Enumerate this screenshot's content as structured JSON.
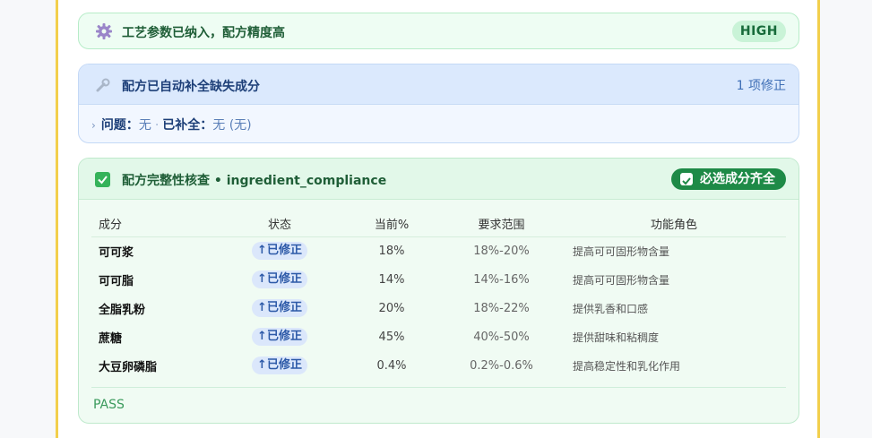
{
  "banner": {
    "title": "工艺参数已纳入，配方精度高",
    "badge": "HIGH",
    "icon": "gear-icon"
  },
  "autofill": {
    "title": "配方已自动补全缺失成分",
    "count": "1 项修正",
    "icon": "wrench-icon",
    "issue_label": "问题：",
    "issue_value": "无",
    "filled_label": "已补全：",
    "filled_value": "无 (无)"
  },
  "compliance": {
    "title": "配方完整性核查 • ingredient_compliance",
    "pill": "必选成分齐全",
    "columns": [
      "成分",
      "状态",
      "当前%",
      "要求范围",
      "功能角色"
    ],
    "rows": [
      {
        "name": "可可浆",
        "status": "↑已修正",
        "current": "18%",
        "range": "18%-20%",
        "role": "提高可可固形物含量"
      },
      {
        "name": "可可脂",
        "status": "↑已修正",
        "current": "14%",
        "range": "14%-16%",
        "role": "提高可可固形物含量"
      },
      {
        "name": "全脂乳粉",
        "status": "↑已修正",
        "current": "20%",
        "range": "18%-22%",
        "role": "提供乳香和口感"
      },
      {
        "name": "蔗糖",
        "status": "↑已修正",
        "current": "45%",
        "range": "40%-50%",
        "role": "提供甜味和粘稠度"
      },
      {
        "name": "大豆卵磷脂",
        "status": "↑已修正",
        "current": "0.4%",
        "range": "0.2%-0.6%",
        "role": "提高稳定性和乳化作用"
      }
    ],
    "result": "PASS"
  },
  "colors": {
    "frame_accent": "#f2cf4c",
    "green_pill": "#1e8a47",
    "status_badge_bg": "#dbe7fb"
  }
}
